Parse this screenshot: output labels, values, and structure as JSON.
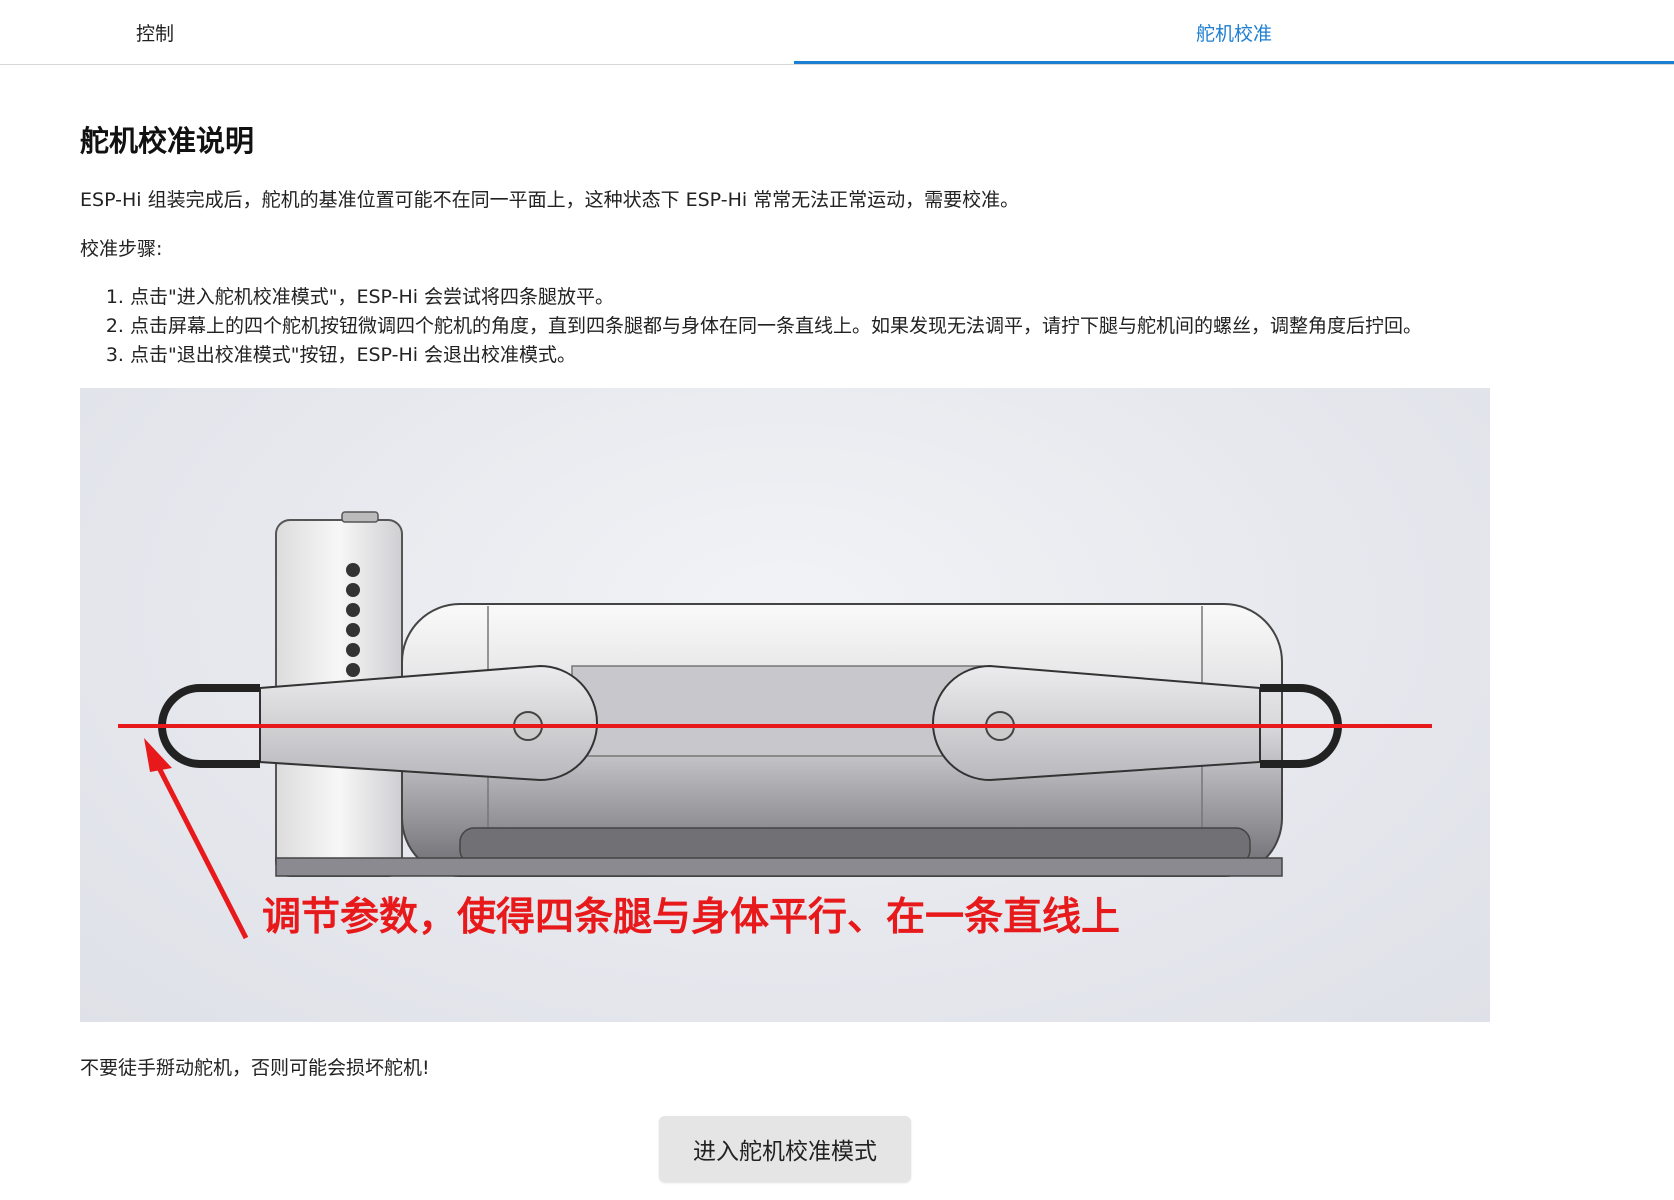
{
  "tabs": [
    {
      "label": "控制",
      "active": false
    },
    {
      "label": "舵机校准",
      "active": true
    }
  ],
  "colors": {
    "accent": "#1d7fd1",
    "annotation_red": "#e8191b"
  },
  "main": {
    "title": "舵机校准说明",
    "intro": "ESP-Hi 组装完成后，舵机的基准位置可能不在同一平面上，这种状态下 ESP-Hi 常常无法正常运动，需要校准。",
    "steps_title": "校准步骤:",
    "steps": [
      "点击\"进入舵机校准模式\"，ESP-Hi 会尝试将四条腿放平。",
      "点击屏幕上的四个舵机按钮微调四个舵机的角度，直到四条腿都与身体在同一条直线上。如果发现无法调平，请拧下腿与舵机间的螺丝，调整角度后拧回。",
      "点击\"退出校准模式\"按钮，ESP-Hi 会退出校准模式。"
    ],
    "figure_caption": "调节参数，使得四条腿与身体平行、在一条直线上",
    "warning": "不要徒手掰动舵机，否则可能会损坏舵机!",
    "enter_button": "进入舵机校准模式"
  }
}
